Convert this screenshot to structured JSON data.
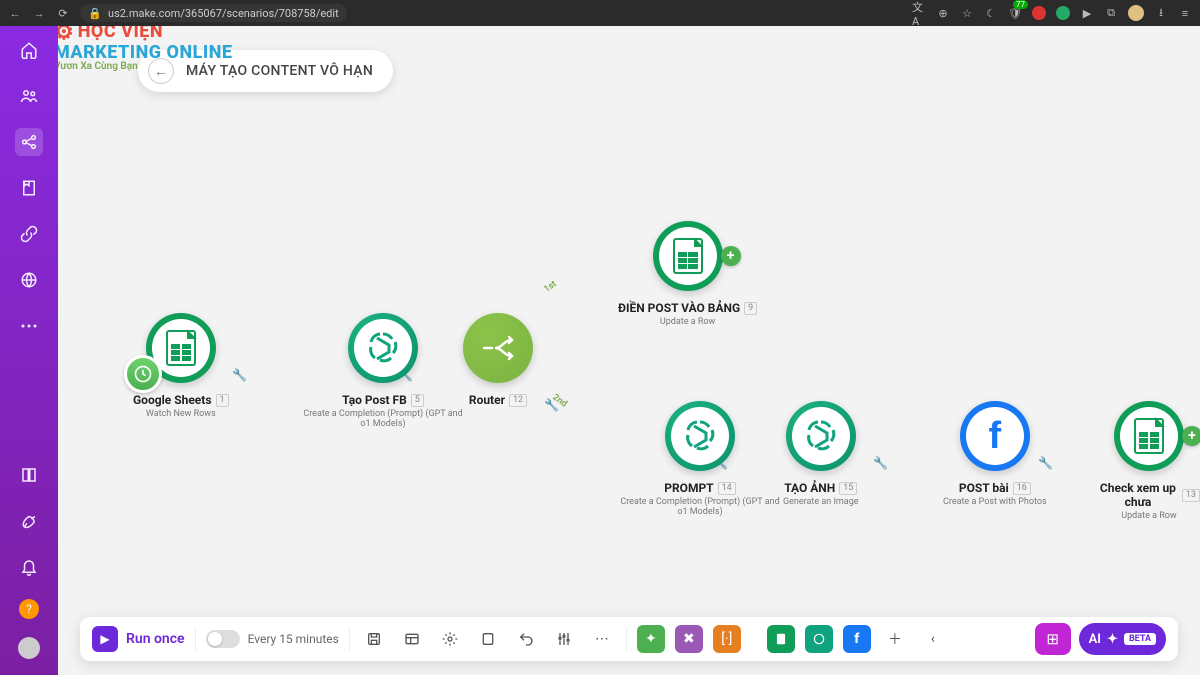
{
  "browser": {
    "url": "us2.make.com/365067/scenarios/708758/edit",
    "ext_badge": "77"
  },
  "watermark": {
    "line1": "HỌC VIỆN",
    "line2": "MARKETING ONLINE",
    "line3": "Vươn Xa Cùng Bạn"
  },
  "scenario": {
    "title": "MÁY TẠO CONTENT VÔ HẠN"
  },
  "nodes": {
    "n1": {
      "title": "Google Sheets",
      "idx": "1",
      "sub": "Watch New Rows"
    },
    "n2": {
      "title": "Tạo Post FB",
      "idx": "5",
      "sub": "Create a Completion (Prompt) (GPT and o1 Models)"
    },
    "n3": {
      "title": "Router",
      "idx": "12",
      "sub": ""
    },
    "n4": {
      "title": "ĐIỀN POST VÀO BẢNG",
      "idx": "9",
      "sub": "Update a Row"
    },
    "n5": {
      "title": "PROMPT",
      "idx": "14",
      "sub": "Create a Completion (Prompt) (GPT and o1 Models)"
    },
    "n6": {
      "title": "TẠO ẢNH",
      "idx": "15",
      "sub": "Generate an Image"
    },
    "n7": {
      "title": "POST bài",
      "idx": "16",
      "sub": "Create a Post with Photos"
    },
    "n8": {
      "title": "Check xem up chưa",
      "idx": "13",
      "sub": "Update a Row"
    }
  },
  "router_paths": {
    "p1": "1st",
    "p2": "2nd"
  },
  "toolbar": {
    "run": "Run once",
    "schedule": "Every 15 minutes",
    "ai": "AI",
    "beta": "BETA"
  }
}
